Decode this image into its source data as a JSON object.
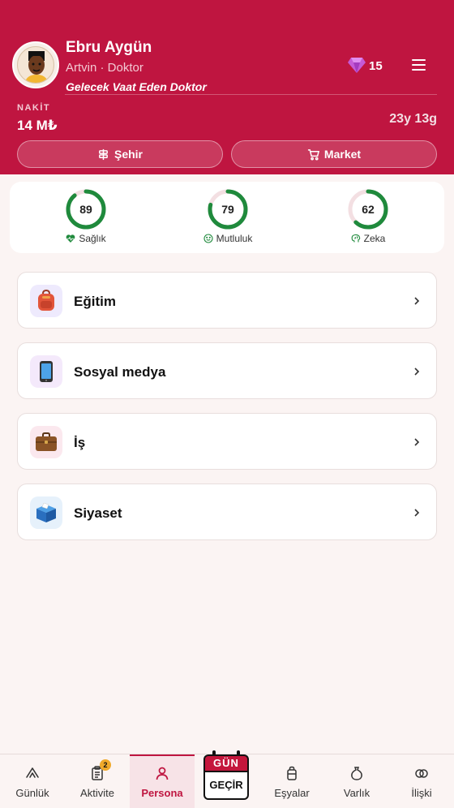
{
  "profile": {
    "name": "Ebru Aygün",
    "subtitle": "Artvin · Doktor",
    "title": "Gelecek Vaat Eden Doktor",
    "gems": "15",
    "cash_label": "NAKİT",
    "cash_value": "14 M₺",
    "age": "23y 13g"
  },
  "header_buttons": {
    "city": "Şehir",
    "market": "Market"
  },
  "stats": [
    {
      "label": "Sağlık",
      "value": 89,
      "icon": "heart-pulse-icon"
    },
    {
      "label": "Mutluluk",
      "value": 79,
      "icon": "smile-icon"
    },
    {
      "label": "Zeka",
      "value": 62,
      "icon": "brain-icon"
    }
  ],
  "cards": [
    {
      "label": "Eğitim",
      "icon": "backpack-icon",
      "emoji": "🎒"
    },
    {
      "label": "Sosyal medya",
      "icon": "phone-icon",
      "emoji": "📱"
    },
    {
      "label": "İş",
      "icon": "briefcase-icon",
      "emoji": "💼"
    },
    {
      "label": "Siyaset",
      "icon": "ballot-box-icon",
      "emoji": "🗳️"
    }
  ],
  "nav": [
    {
      "label": "Günlük"
    },
    {
      "label": "Aktivite",
      "badge": "2"
    },
    {
      "label": "Persona",
      "active": true
    },
    {
      "label": "Eşyalar"
    },
    {
      "label": "Varlık"
    },
    {
      "label": "İlişki"
    }
  ],
  "calendar": {
    "top": "GÜN",
    "bottom": "GEÇİR"
  },
  "colors": {
    "brand": "#bf1540",
    "ring": "#1f8a3c",
    "background": "#fbf4f3"
  }
}
